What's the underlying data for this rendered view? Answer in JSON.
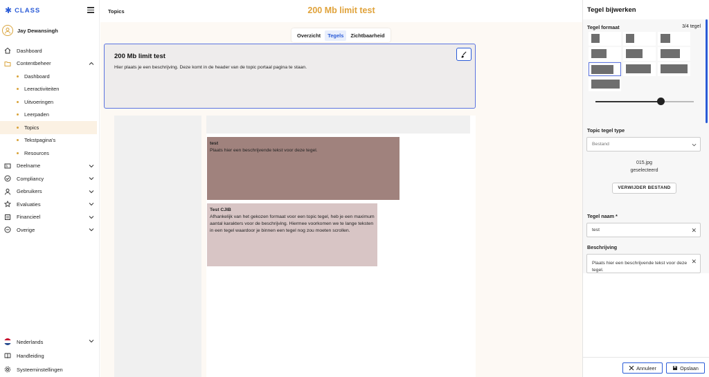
{
  "brand": {
    "name": "CLASS"
  },
  "user": {
    "name": "Jay Dewansingh"
  },
  "sidebar": {
    "items": [
      {
        "label": "Dashboard"
      },
      {
        "label": "Contentbeheer"
      }
    ],
    "sub_items": [
      {
        "label": "Dashboard"
      },
      {
        "label": "Leeractiviteiten"
      },
      {
        "label": "Uitvoeringen"
      },
      {
        "label": "Leerpaden"
      },
      {
        "label": "Topics"
      },
      {
        "label": "Tekstpagina's"
      },
      {
        "label": "Resources"
      }
    ],
    "more_items": [
      {
        "label": "Deelname"
      },
      {
        "label": "Compliancy"
      },
      {
        "label": "Gebruikers"
      },
      {
        "label": "Evaluaties"
      },
      {
        "label": "Financieel"
      },
      {
        "label": "Overige"
      }
    ],
    "bottom_items": [
      {
        "label": "Nederlands"
      },
      {
        "label": "Handleiding"
      },
      {
        "label": "Systeeminstellingen"
      }
    ]
  },
  "header": {
    "breadcrumb": "Topics",
    "title": "200 Mb limit test"
  },
  "tabs": [
    {
      "label": "Overzicht"
    },
    {
      "label": "Tegels"
    },
    {
      "label": "Zichtbaarheid"
    }
  ],
  "hero": {
    "title": "200 Mb limit test",
    "description": "Hier plaats je een beschrijving. Deze komt in de header van de topic portaal pagina te staan."
  },
  "tiles": [
    {
      "title": "test",
      "description": "Plaats hier een beschrijvende tekst voor deze tegel."
    },
    {
      "title": "Test CJIB",
      "description": "Afhankelijk van het gekozen formaat voor een topic tegel, heb je een maximum aantal karakters voor de beschrijving. Hiermee voorkomen we te lange teksten in een tegel waardoor je binnen een tegel nog zou moeten scrollen."
    }
  ],
  "panel": {
    "title": "Tegel bijwerken",
    "format_label": "Tegel formaat",
    "format_count": "3/4 tegel",
    "type_label": "Topic tegel type",
    "type_value": "Bestand",
    "file_name": "015.jpg",
    "file_status": "geselecteerd",
    "remove_button": "VERWIJDER BESTAND",
    "name_label": "Tegel naam *",
    "name_value": "test",
    "desc_label": "Beschrijving",
    "desc_value": "Plaats hier een beschrijvende tekst voor deze tegel.",
    "cancel": "Annuleer",
    "save": "Opslaan"
  },
  "colors": {
    "accent": "#2a5bd7",
    "brand_gold": "#e0a23a",
    "tile1": "#a0827d",
    "tile2": "#d8c5c5"
  },
  "slider": {
    "value_fraction": 0.66
  }
}
